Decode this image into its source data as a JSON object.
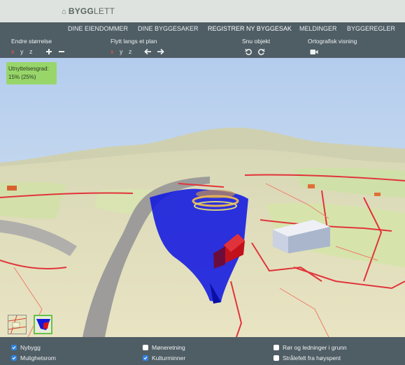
{
  "brand": {
    "part1": "BYGG",
    "part2": "LETT"
  },
  "nav": [
    {
      "label": "DINE EIENDOMMER",
      "active": false
    },
    {
      "label": "DINE BYGGESAKER",
      "active": false
    },
    {
      "label": "REGISTRER NY BYGGESAK",
      "active": true
    },
    {
      "label": "MELDINGER",
      "active": false
    },
    {
      "label": "BYGGEREGLER",
      "active": false
    }
  ],
  "toolbar": {
    "resize": {
      "title": "Endre størrelse",
      "x": "x",
      "y": "y",
      "z": "z",
      "plus_icon": "plus-icon",
      "minus_icon": "minus-icon"
    },
    "move": {
      "title": "Flytt langs et plan",
      "x": "x",
      "y": "y",
      "z": "z",
      "left_icon": "arrow-left-icon",
      "right_icon": "arrow-right-icon"
    },
    "rotate": {
      "title": "Snu objekt",
      "ccw_icon": "rotate-ccw-icon",
      "cw_icon": "rotate-cw-icon"
    },
    "ortho": {
      "title": "Ortografisk visning",
      "icon": "video-camera-icon"
    }
  },
  "utilization": {
    "label": "Utnyttelsesgrad:",
    "value": "15% (25%)"
  },
  "colors": {
    "accent_bar": "#4f5d64",
    "active_axis": "#e35a4c",
    "utilization_badge": "#98d66a",
    "checkbox_checked": "#2f84e0",
    "selected_thumb": "#67c24a"
  },
  "layers": [
    {
      "label": "Nybygg",
      "checked": true
    },
    {
      "label": "Mulighetsrom",
      "checked": true
    },
    {
      "label": "Møneretning",
      "checked": false
    },
    {
      "label": "Kulturminner",
      "checked": true
    },
    {
      "label": "Rør og ledninger i grunn",
      "checked": false
    },
    {
      "label": "Strålefelt fra høyspent",
      "checked": false
    }
  ]
}
